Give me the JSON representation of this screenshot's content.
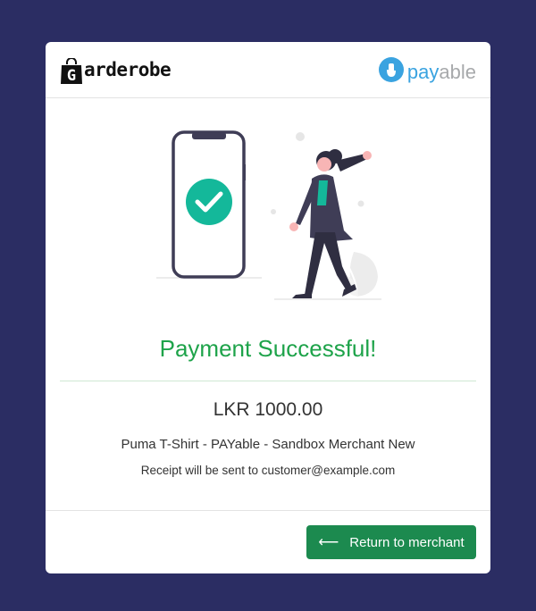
{
  "brand": {
    "logo_letter": "G",
    "logo_text": "arderobe",
    "payable_pay": "pay",
    "payable_able": "able"
  },
  "status": {
    "title": "Payment Successful!",
    "amount": "LKR 1000.00",
    "description": "Puma T-Shirt - PAYable - Sandbox Merchant New",
    "receipt": "Receipt will be sent to customer@example.com"
  },
  "footer": {
    "return_label": "Return to merchant",
    "return_icon": "arrow-left-icon"
  },
  "colors": {
    "background": "#2b2d63",
    "success": "#1ea34a",
    "button": "#1c8a4f",
    "check": "#14b89a"
  }
}
